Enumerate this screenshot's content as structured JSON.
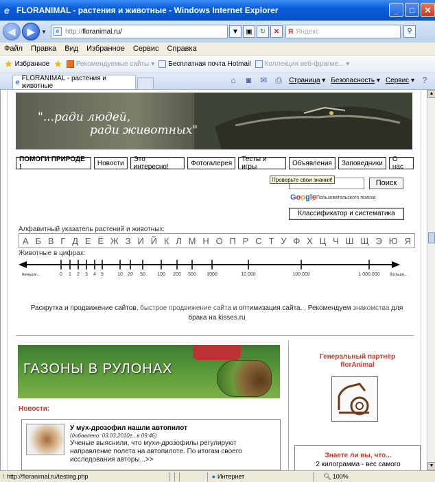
{
  "window": {
    "title": "FLORANIMAL - растения и животные - Windows Internet Explorer"
  },
  "address": {
    "proto": "http://",
    "host": "floranimal.ru/",
    "search_placeholder": "Яндекс",
    "search_brand": "Я"
  },
  "menu": [
    "Файл",
    "Правка",
    "Вид",
    "Избранное",
    "Сервис",
    "Справка"
  ],
  "favorites": {
    "label": "Избранное",
    "items": [
      "Рекомендуемые сайты",
      "Бесплатная почта Hotmail",
      "Коллекция веб-фрагме..."
    ]
  },
  "tab": {
    "label": "FLORANIMAL - растения и животные"
  },
  "commands": [
    "Страница",
    "Безопасность",
    "Сервис"
  ],
  "banner": {
    "line1": "\"...ради людей,",
    "line2": "ради животных\""
  },
  "nav": [
    "ПОМОГИ ПРИРОДЕ !",
    "Новости",
    "Это интересно!",
    "Фотогалерея",
    "Тесты и игры",
    "Объявления",
    "Заповедники",
    "О нас"
  ],
  "search": {
    "tooltip": "Проверьте свои знания!",
    "button": "Поиск",
    "google_label": "Пользовательского поиска"
  },
  "classifier": "Классификатор и систематика",
  "alphabet": {
    "title": "Алфавитный указатель растений и животных:",
    "letters": [
      "А",
      "Б",
      "В",
      "Г",
      "Д",
      "Е",
      "Ё",
      "Ж",
      "З",
      "И",
      "Й",
      "К",
      "Л",
      "М",
      "Н",
      "О",
      "П",
      "Р",
      "С",
      "Т",
      "У",
      "Ф",
      "Х",
      "Ц",
      "Ч",
      "Ш",
      "Щ",
      "Э",
      "Ю",
      "Я"
    ]
  },
  "numbers": {
    "title": "Животные в цифрах:",
    "labels": [
      "меньше...",
      "0",
      "1",
      "2",
      "3",
      "4",
      "5",
      "10",
      "20",
      "50",
      "100",
      "200",
      "500",
      "1000",
      "10 000",
      "100 000",
      "1 000 000",
      "больше..."
    ]
  },
  "promo": {
    "p1": "Раскрутка и продвижение сайтов",
    "p2": ", ",
    "p3": "быстрое продвижение сайта",
    "p4": " и ",
    "p5": "оптимизация сайта",
    "p6": ". , Рекомендуем ",
    "p7": "знакомства",
    "p8": " для брака на kisses.ru"
  },
  "lawn": {
    "text": "ГАЗОНЫ В РУЛОНАХ"
  },
  "news": {
    "title": "Новости:",
    "item_title": "У мух-дрозофил нашли автопилот",
    "item_date": "(добавлено: 03.03.2010г., в 09:46)",
    "item_text": "Ученые выяснили, что мухи-дрозофилы регулируют направление полета на автопилоте. По итогам своего исследования авторы...>>"
  },
  "partner": {
    "line1": "Генеральный партнёр",
    "line2": "florAnimal"
  },
  "know": {
    "title": "Знаете ли вы, что...",
    "text": "2 килограмма - вес самого"
  },
  "status": {
    "url": "http://floranimal.ru/testing.php",
    "zone": "Интернет",
    "zoom": "100%"
  }
}
